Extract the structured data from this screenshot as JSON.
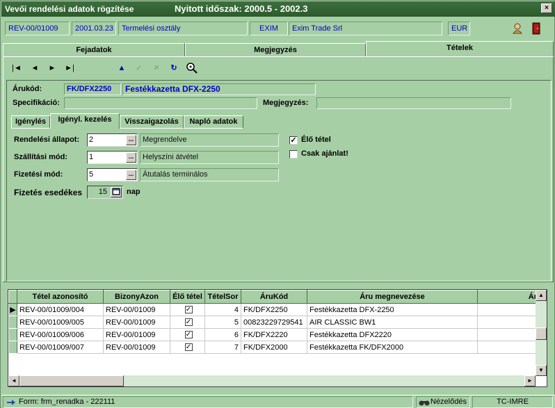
{
  "window": {
    "title": "Vevői rendelési adatok rögzítése",
    "period": "Nyitott időszak: 2000.5 - 2002.3",
    "close": "×"
  },
  "infobar": {
    "doc_id": "REV-00/01009",
    "date": "2001.03.23",
    "dept": "Termelési osztály",
    "code": "EXIM",
    "partner": "Exim Trade Srl",
    "currency": "EUR"
  },
  "tabs": [
    {
      "label": "Fejadatok"
    },
    {
      "label": "Megjegyzés"
    },
    {
      "label": "Tételek"
    }
  ],
  "nav": {
    "first": "|◄",
    "prev": "◄",
    "next": "►",
    "last": "►|",
    "up": "▲",
    "ok": "✓",
    "cancel": "✕",
    "refresh": "↻"
  },
  "item": {
    "code_label": "Árukód:",
    "code": "FK/DFX2250",
    "name": "Festékkazetta DFX-2250",
    "spec_label": "Specifikáció:",
    "spec": "",
    "note_label": "Megjegyzés:",
    "note": ""
  },
  "subtabs": [
    {
      "label": "Igénylés"
    },
    {
      "label": "Igényl. kezelés"
    },
    {
      "label": "Visszaigazolás"
    },
    {
      "label": "Napló adatok"
    }
  ],
  "form": {
    "order_state_label": "Rendelési állapot:",
    "order_state_value": "2",
    "order_state_desc": "Megrendelve",
    "ship_label": "Szállítási mód:",
    "ship_value": "1",
    "ship_desc": "Helyszíni átvétel",
    "pay_label": "Fizetési mód:",
    "pay_value": "5",
    "pay_desc": "Átutalás terminálos",
    "due_label": "Fizetés esedékes",
    "due_value": "15",
    "due_unit": "nap",
    "live_label": "Élő tétel",
    "live_checked": "✓",
    "offer_label": "Csak ajánlat!",
    "offer_checked": ""
  },
  "grid": {
    "columns": [
      "Tétel azonosító",
      "BizonyAzon",
      "Élő tétel",
      "TételSor",
      "ÁruKód",
      "Áru megnevezése",
      "Ár"
    ],
    "rows": [
      {
        "ind": "▶",
        "id": "REV-00/01009/004",
        "doc": "REV-00/01009",
        "live": "✓",
        "line": "4",
        "code": "FK/DFX2250",
        "name": "Festékkazetta DFX-2250"
      },
      {
        "ind": "",
        "id": "REV-00/01009/005",
        "doc": "REV-00/01009",
        "live": "✓",
        "line": "5",
        "code": "00823229729541",
        "name": "AIR CLASSIC BW1"
      },
      {
        "ind": "",
        "id": "REV-00/01009/006",
        "doc": "REV-00/01009",
        "live": "✓",
        "line": "6",
        "code": "FK/DFX2220",
        "name": "Festékkazetta DFX2220"
      },
      {
        "ind": "",
        "id": "REV-00/01009/007",
        "doc": "REV-00/01009",
        "live": "✓",
        "line": "7",
        "code": "FK/DFX2000",
        "name": "Festékkazetta FK/DFX2000"
      }
    ]
  },
  "status": {
    "form": "Form: frm_renadka - 222111",
    "mode": "Nézelődés",
    "user": "TC-IMRE"
  }
}
